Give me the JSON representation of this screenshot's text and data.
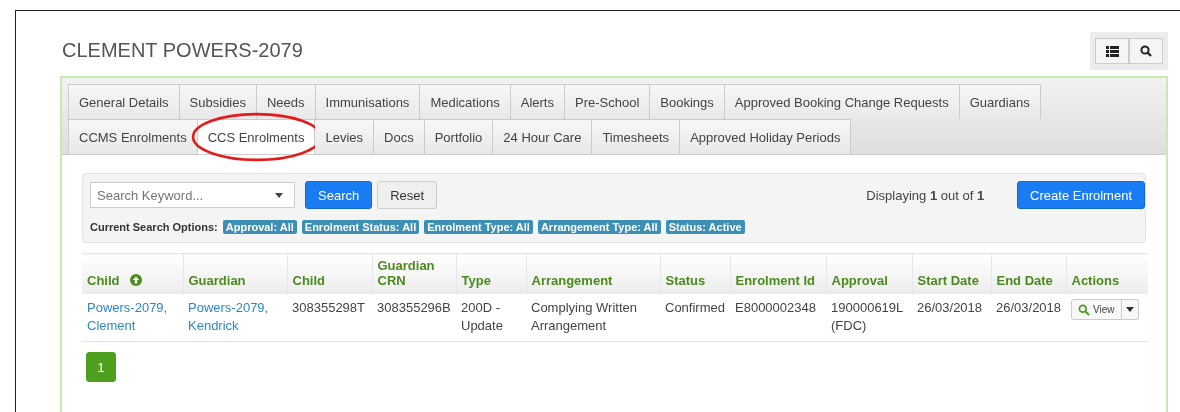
{
  "page": {
    "title": "CLEMENT POWERS-2079"
  },
  "toolbar": [
    {
      "kind": "list"
    },
    {
      "kind": "search"
    }
  ],
  "tab_rows": [
    {
      "tabs": [
        {
          "label": "General Details",
          "selected": false
        },
        {
          "label": "Subsidies",
          "selected": false
        },
        {
          "label": "Needs",
          "selected": false
        },
        {
          "label": "Immunisations",
          "selected": false
        },
        {
          "label": "Medications",
          "selected": false
        },
        {
          "label": "Alerts",
          "selected": false
        },
        {
          "label": "Pre-School",
          "selected": false
        },
        {
          "label": "Bookings",
          "selected": false
        },
        {
          "label": "Approved Booking Change Requests",
          "selected": false
        },
        {
          "label": "Guardians",
          "selected": false
        }
      ]
    },
    {
      "tabs": [
        {
          "label": "CCMS Enrolments",
          "selected": false
        },
        {
          "label": "CCS Enrolments",
          "selected": true,
          "circled": true
        },
        {
          "label": "Levies",
          "selected": false
        },
        {
          "label": "Docs",
          "selected": false
        },
        {
          "label": "Portfolio",
          "selected": false
        },
        {
          "label": "24 Hour Care",
          "selected": false
        },
        {
          "label": "Timesheets",
          "selected": false
        },
        {
          "label": "Approved Holiday Periods",
          "selected": false
        }
      ]
    }
  ],
  "search": {
    "placeholder": "Search Keyword...",
    "search_button": "Search",
    "reset_button": "Reset",
    "displaying": "Displaying **1** out of **1**",
    "create_button": "Create Enrolment",
    "options_label": "Current Search Options:",
    "options": [
      "Approval: All",
      "Enrolment Status: All",
      "Enrolment Type: All",
      "Arrangement Type: All",
      "Status: Active"
    ]
  },
  "table": {
    "columns": [
      {
        "label": "Child",
        "sorted": true
      },
      {
        "label": "Guardian",
        "sorted": false
      },
      {
        "label": "Child",
        "sorted": false
      },
      {
        "label": "Guardian CRN",
        "sorted": false
      },
      {
        "label": "Type",
        "sorted": false
      },
      {
        "label": "Arrangement",
        "sorted": false
      },
      {
        "label": "Status",
        "sorted": false
      },
      {
        "label": "Enrolment Id",
        "sorted": false
      },
      {
        "label": "Approval",
        "sorted": false
      },
      {
        "label": "Start Date",
        "sorted": false
      },
      {
        "label": "End Date",
        "sorted": false
      },
      {
        "label": "Actions",
        "sorted": false
      }
    ],
    "rows": [
      {
        "cells": [
          {
            "kind": "link",
            "text": "Powers-2079, Clement"
          },
          {
            "kind": "link",
            "text": "Powers-2079, Kendrick"
          },
          {
            "kind": "text",
            "text": "308355298T"
          },
          {
            "kind": "text",
            "text": "308355296B"
          },
          {
            "kind": "text",
            "text": "200D - Update"
          },
          {
            "kind": "text",
            "text": "Complying Written Arrangement"
          },
          {
            "kind": "text",
            "text": "Confirmed"
          },
          {
            "kind": "text",
            "text": "E8000002348"
          },
          {
            "kind": "text",
            "text": "190000619L (FDC)"
          },
          {
            "kind": "text",
            "text": "26/03/2018"
          },
          {
            "kind": "text",
            "text": "26/03/2018"
          },
          {
            "kind": "action",
            "text": "View"
          }
        ]
      }
    ]
  },
  "pagination": [
    {
      "label": "1",
      "selected": true
    }
  ]
}
